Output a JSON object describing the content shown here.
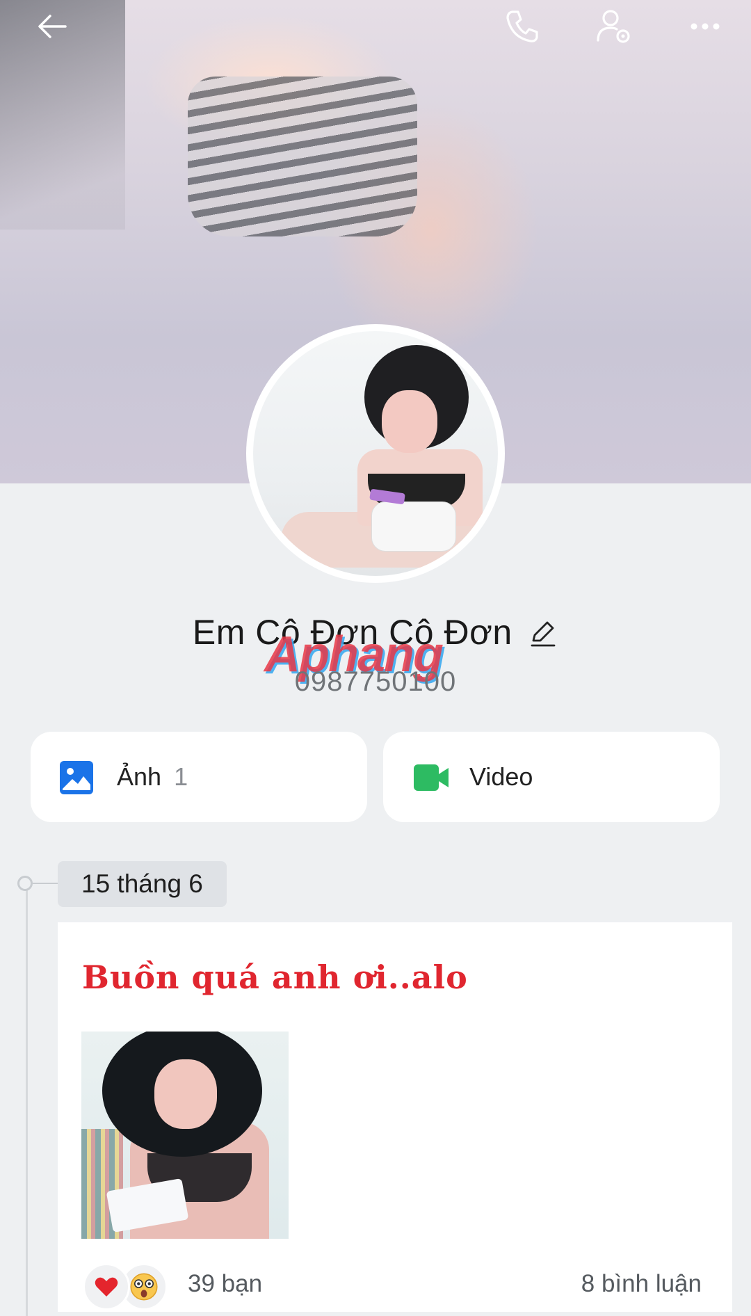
{
  "header": {
    "icons": [
      "back-arrow-icon",
      "phone-call-icon",
      "user-settings-icon",
      "more-icon"
    ]
  },
  "profile": {
    "name": "Em Cô Đơn Cô Đơn",
    "phone": "0987750100",
    "watermark": "Aphang"
  },
  "media": [
    {
      "label": "Ảnh",
      "count": "1",
      "icon": "photo-icon",
      "color": "#1a73e8"
    },
    {
      "label": "Video",
      "count": "",
      "icon": "video-icon",
      "color": "#2dbb62"
    }
  ],
  "timeline": {
    "date": "15 tháng 6"
  },
  "post": {
    "title": "Buồn quá anh ơi..alo",
    "reactions": [
      "heart-icon",
      "surprised-face-icon"
    ],
    "likes": "39 bạn",
    "comments": "8 bình luận"
  },
  "colors": {
    "title_red": "#e0262f",
    "background": "#eef0f2"
  }
}
